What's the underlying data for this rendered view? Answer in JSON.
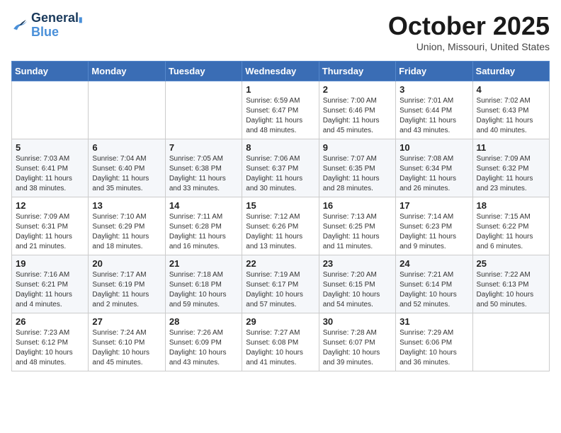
{
  "logo": {
    "line1": "General",
    "line2": "Blue"
  },
  "title": "October 2025",
  "subtitle": "Union, Missouri, United States",
  "weekdays": [
    "Sunday",
    "Monday",
    "Tuesday",
    "Wednesday",
    "Thursday",
    "Friday",
    "Saturday"
  ],
  "weeks": [
    [
      null,
      null,
      null,
      {
        "day": "1",
        "sunrise": "6:59 AM",
        "sunset": "6:47 PM",
        "daylight": "11 hours and 48 minutes."
      },
      {
        "day": "2",
        "sunrise": "7:00 AM",
        "sunset": "6:46 PM",
        "daylight": "11 hours and 45 minutes."
      },
      {
        "day": "3",
        "sunrise": "7:01 AM",
        "sunset": "6:44 PM",
        "daylight": "11 hours and 43 minutes."
      },
      {
        "day": "4",
        "sunrise": "7:02 AM",
        "sunset": "6:43 PM",
        "daylight": "11 hours and 40 minutes."
      }
    ],
    [
      {
        "day": "5",
        "sunrise": "7:03 AM",
        "sunset": "6:41 PM",
        "daylight": "11 hours and 38 minutes."
      },
      {
        "day": "6",
        "sunrise": "7:04 AM",
        "sunset": "6:40 PM",
        "daylight": "11 hours and 35 minutes."
      },
      {
        "day": "7",
        "sunrise": "7:05 AM",
        "sunset": "6:38 PM",
        "daylight": "11 hours and 33 minutes."
      },
      {
        "day": "8",
        "sunrise": "7:06 AM",
        "sunset": "6:37 PM",
        "daylight": "11 hours and 30 minutes."
      },
      {
        "day": "9",
        "sunrise": "7:07 AM",
        "sunset": "6:35 PM",
        "daylight": "11 hours and 28 minutes."
      },
      {
        "day": "10",
        "sunrise": "7:08 AM",
        "sunset": "6:34 PM",
        "daylight": "11 hours and 26 minutes."
      },
      {
        "day": "11",
        "sunrise": "7:09 AM",
        "sunset": "6:32 PM",
        "daylight": "11 hours and 23 minutes."
      }
    ],
    [
      {
        "day": "12",
        "sunrise": "7:09 AM",
        "sunset": "6:31 PM",
        "daylight": "11 hours and 21 minutes."
      },
      {
        "day": "13",
        "sunrise": "7:10 AM",
        "sunset": "6:29 PM",
        "daylight": "11 hours and 18 minutes."
      },
      {
        "day": "14",
        "sunrise": "7:11 AM",
        "sunset": "6:28 PM",
        "daylight": "11 hours and 16 minutes."
      },
      {
        "day": "15",
        "sunrise": "7:12 AM",
        "sunset": "6:26 PM",
        "daylight": "11 hours and 13 minutes."
      },
      {
        "day": "16",
        "sunrise": "7:13 AM",
        "sunset": "6:25 PM",
        "daylight": "11 hours and 11 minutes."
      },
      {
        "day": "17",
        "sunrise": "7:14 AM",
        "sunset": "6:23 PM",
        "daylight": "11 hours and 9 minutes."
      },
      {
        "day": "18",
        "sunrise": "7:15 AM",
        "sunset": "6:22 PM",
        "daylight": "11 hours and 6 minutes."
      }
    ],
    [
      {
        "day": "19",
        "sunrise": "7:16 AM",
        "sunset": "6:21 PM",
        "daylight": "11 hours and 4 minutes."
      },
      {
        "day": "20",
        "sunrise": "7:17 AM",
        "sunset": "6:19 PM",
        "daylight": "11 hours and 2 minutes."
      },
      {
        "day": "21",
        "sunrise": "7:18 AM",
        "sunset": "6:18 PM",
        "daylight": "10 hours and 59 minutes."
      },
      {
        "day": "22",
        "sunrise": "7:19 AM",
        "sunset": "6:17 PM",
        "daylight": "10 hours and 57 minutes."
      },
      {
        "day": "23",
        "sunrise": "7:20 AM",
        "sunset": "6:15 PM",
        "daylight": "10 hours and 54 minutes."
      },
      {
        "day": "24",
        "sunrise": "7:21 AM",
        "sunset": "6:14 PM",
        "daylight": "10 hours and 52 minutes."
      },
      {
        "day": "25",
        "sunrise": "7:22 AM",
        "sunset": "6:13 PM",
        "daylight": "10 hours and 50 minutes."
      }
    ],
    [
      {
        "day": "26",
        "sunrise": "7:23 AM",
        "sunset": "6:12 PM",
        "daylight": "10 hours and 48 minutes."
      },
      {
        "day": "27",
        "sunrise": "7:24 AM",
        "sunset": "6:10 PM",
        "daylight": "10 hours and 45 minutes."
      },
      {
        "day": "28",
        "sunrise": "7:26 AM",
        "sunset": "6:09 PM",
        "daylight": "10 hours and 43 minutes."
      },
      {
        "day": "29",
        "sunrise": "7:27 AM",
        "sunset": "6:08 PM",
        "daylight": "10 hours and 41 minutes."
      },
      {
        "day": "30",
        "sunrise": "7:28 AM",
        "sunset": "6:07 PM",
        "daylight": "10 hours and 39 minutes."
      },
      {
        "day": "31",
        "sunrise": "7:29 AM",
        "sunset": "6:06 PM",
        "daylight": "10 hours and 36 minutes."
      },
      null
    ]
  ]
}
